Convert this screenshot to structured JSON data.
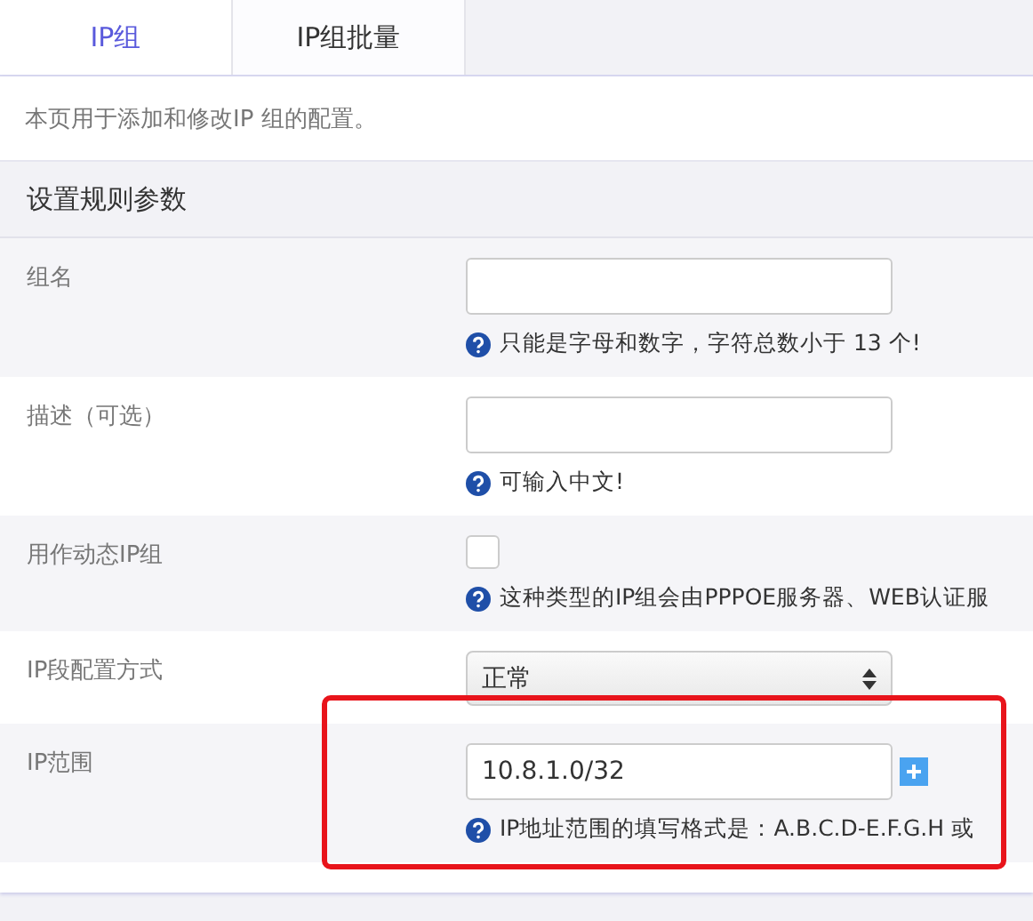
{
  "tabs": [
    {
      "label": "IP组",
      "selected": true
    },
    {
      "label": "IP组批量",
      "selected": false
    }
  ],
  "intro": "本页用于添加和修改IP 组的配置。",
  "section_title": "设置规则参数",
  "rows": [
    {
      "kind": "text",
      "label": "组名",
      "hint": "只能是字母和数字，字符总数小于 13 个!"
    },
    {
      "kind": "text",
      "label": "描述（可选）",
      "hint": "可输入中文!"
    },
    {
      "kind": "checkbox",
      "label": "用作动态IP组",
      "checked": false,
      "hint": "这种类型的IP组会由PPPOE服务器、WEB认证服"
    },
    {
      "kind": "select",
      "label": "IP段配置方式",
      "value": "正常"
    },
    {
      "kind": "text_plus",
      "label": "IP范围",
      "value": "10.8.1.0/32",
      "hint": "IP地址范围的填写格式是：A.B.C.D-E.F.G.H 或"
    }
  ]
}
